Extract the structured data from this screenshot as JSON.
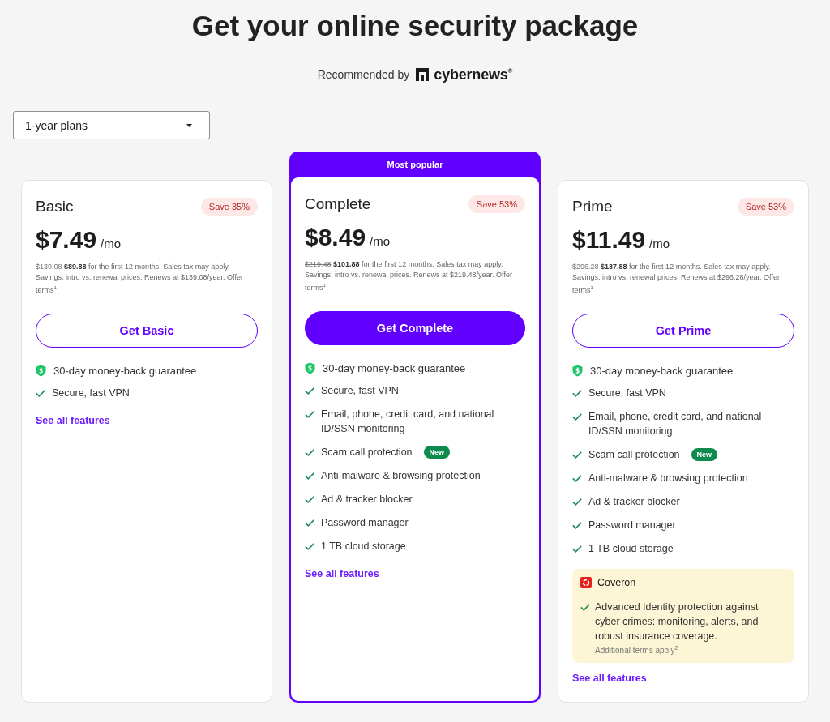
{
  "title": "Get your online security package",
  "recommended": {
    "label": "Recommended by",
    "brand": "cybernews$^{®}$"
  },
  "plan_select": {
    "value": "1-year plans"
  },
  "plans": [
    {
      "name": "Basic",
      "featured": false,
      "save": "Save 35%",
      "price": "$7.49",
      "unit": "/mo",
      "old_price": "$139.08",
      "note": "**$89.88** for the first 12 months. Sales tax may apply. Savings: intro vs. renewal prices. Renews at $139.08/year. Offer terms$^{1}$",
      "button": "Get Basic",
      "guarantee": "30-day money-back guarantee",
      "features": [
        {
          "text": "Secure, fast VPN"
        }
      ],
      "link": "See all features"
    },
    {
      "name": "Complete",
      "featured": true,
      "ribbon": "Most popular",
      "save": "Save 53%",
      "price": "$8.49",
      "unit": "/mo",
      "old_price": "$219.48",
      "note": "**$101.88** for the first 12 months. Sales tax may apply. Savings: intro vs. renewal prices. Renews at $219.48/year. Offer terms$^{1}$",
      "button": "Get Complete",
      "guarantee": "30-day money-back guarantee",
      "features": [
        {
          "text": "Secure, fast VPN"
        },
        {
          "text": "Email, phone, credit card, and national ID/SSN monitoring"
        },
        {
          "text": "Scam call protection",
          "badge": "New"
        },
        {
          "text": "Anti-malware & browsing protection"
        },
        {
          "text": "Ad & tracker blocker"
        },
        {
          "text": "Password manager"
        },
        {
          "text": "1 TB cloud storage"
        }
      ],
      "link": "See all features"
    },
    {
      "name": "Prime",
      "featured": false,
      "save": "Save 53%",
      "price": "$11.49",
      "unit": "/mo",
      "old_price": "$296.28",
      "note": "**$137.88** for the first 12 months. Sales tax may apply. Savings: intro vs. renewal prices. Renews at $296.28/year. Offer terms$^{1}$",
      "button": "Get Prime",
      "guarantee": "30-day money-back guarantee",
      "features": [
        {
          "text": "Secure, fast VPN"
        },
        {
          "text": "Email, phone, credit card, and national ID/SSN monitoring"
        },
        {
          "text": "Scam call protection",
          "badge": "New"
        },
        {
          "text": "Anti-malware & browsing protection"
        },
        {
          "text": "Ad & tracker blocker"
        },
        {
          "text": "Password manager"
        },
        {
          "text": "1 TB cloud storage"
        }
      ],
      "addon": {
        "name": "Coveron",
        "text": "Advanced Identity protection against cyber crimes: monitoring, alerts, and robust insurance coverage.",
        "note": "Additional terms apply$^{2}$"
      },
      "link": "See all features"
    }
  ]
}
